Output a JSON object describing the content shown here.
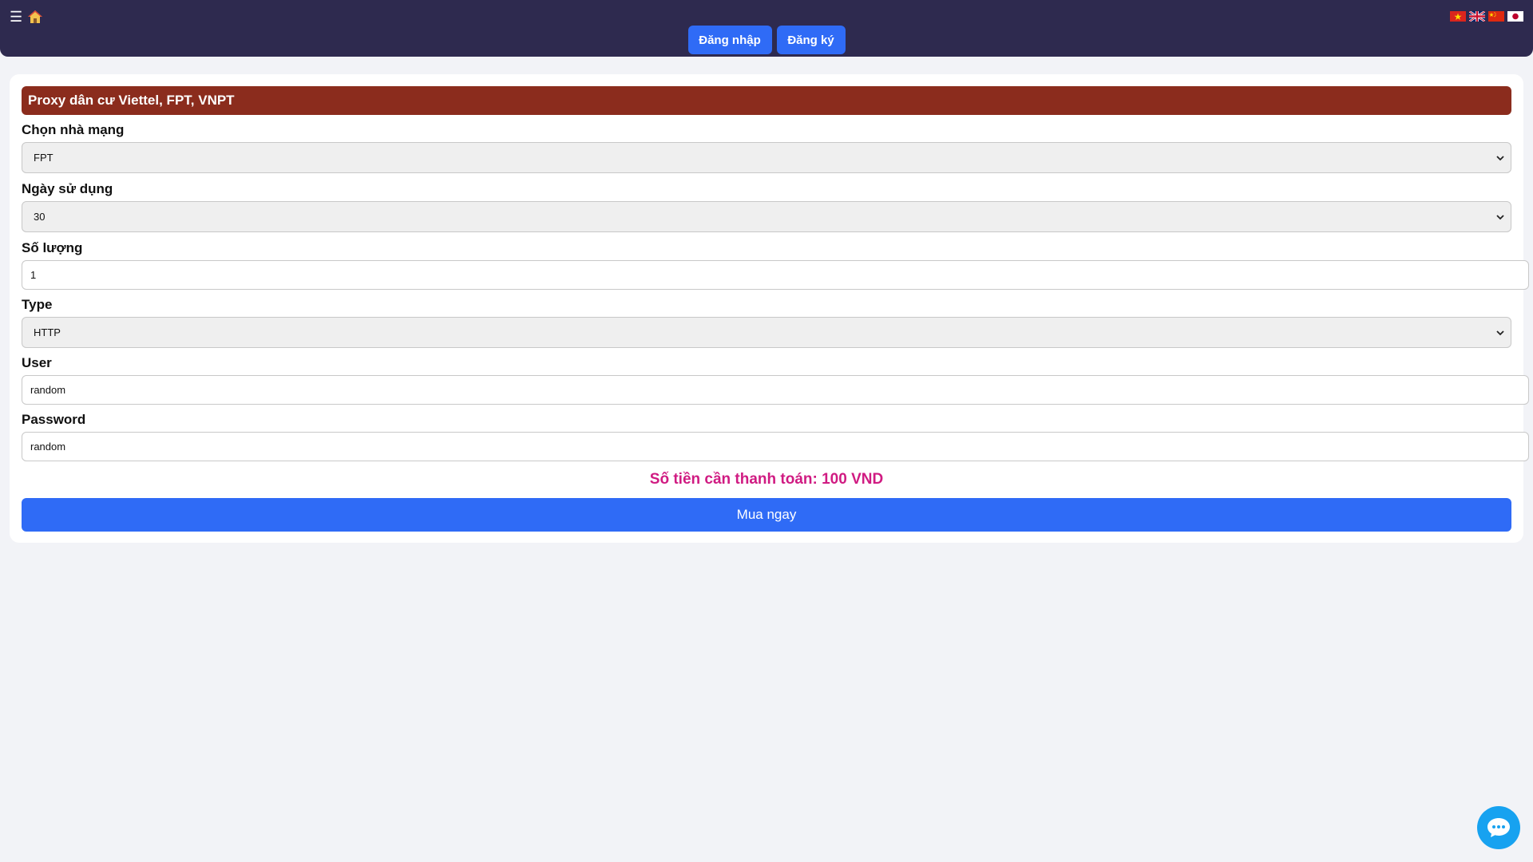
{
  "header": {
    "menu_icon": "☰",
    "home_icon": "home-icon",
    "auth": {
      "login_label": "Đăng nhập",
      "register_label": "Đăng ký"
    },
    "flags": [
      "vietnam-flag-icon",
      "uk-flag-icon",
      "china-flag-icon",
      "japan-flag-icon"
    ]
  },
  "form": {
    "title": "Proxy dân cư Viettel, FPT, VNPT",
    "network": {
      "label": "Chọn nhà mạng",
      "value": "FPT"
    },
    "days": {
      "label": "Ngày sử dụng",
      "value": "30"
    },
    "quantity": {
      "label": "Số lượng",
      "value": "1"
    },
    "type": {
      "label": "Type",
      "value": "HTTP"
    },
    "user": {
      "label": "User",
      "value": "random"
    },
    "password": {
      "label": "Password",
      "value": "random"
    },
    "total_text": "Số tiền cần thanh toán: 100 VND",
    "buy_label": "Mua ngay"
  },
  "colors": {
    "topbar": "#2e2a4f",
    "primary": "#2f6bf6",
    "title_bg": "#8b2c1d",
    "total": "#d01b82",
    "chat": "#17a2f0"
  },
  "chat_icon": "chat-bubble-icon"
}
